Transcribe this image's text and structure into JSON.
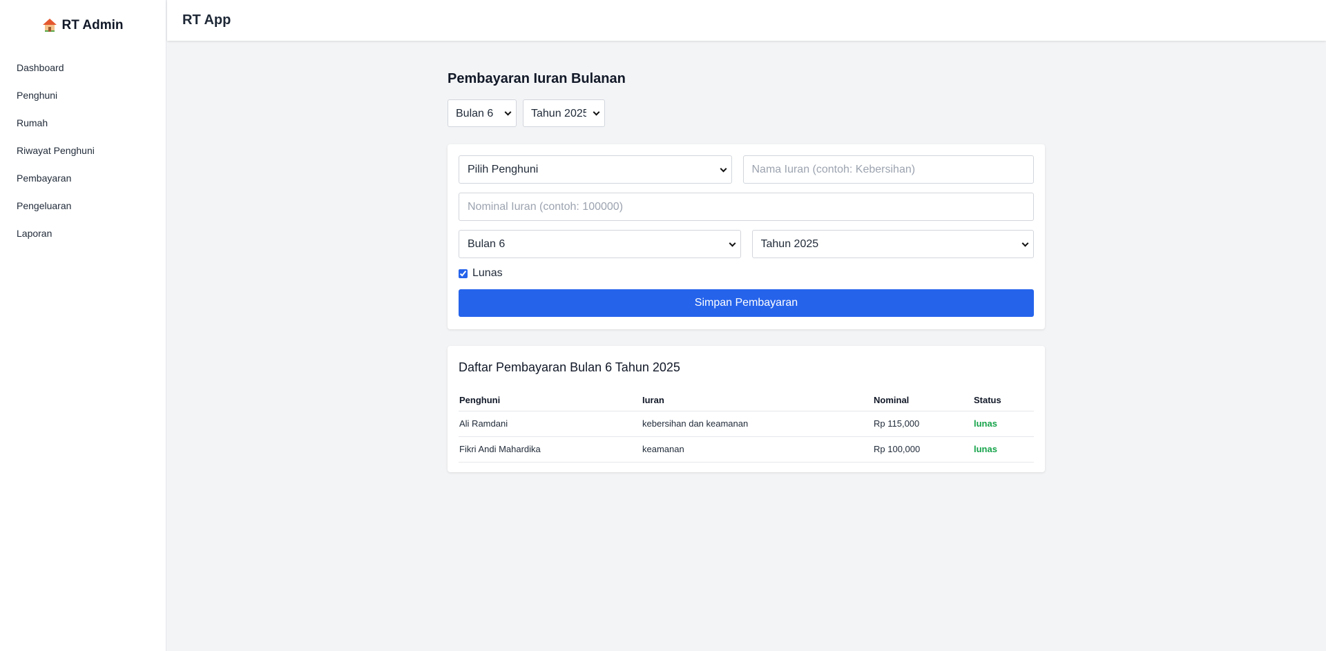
{
  "sidebar": {
    "brand": "RT Admin",
    "brand_icon": "house-icon",
    "items": [
      {
        "label": "Dashboard"
      },
      {
        "label": "Penghuni"
      },
      {
        "label": "Rumah"
      },
      {
        "label": "Riwayat Penghuni"
      },
      {
        "label": "Pembayaran"
      },
      {
        "label": "Pengeluaran"
      },
      {
        "label": "Laporan"
      }
    ]
  },
  "header": {
    "title": "RT App"
  },
  "main": {
    "title": "Pembayaran Iuran Bulanan",
    "filter": {
      "month": "Bulan 6",
      "year": "Tahun 2025"
    },
    "form": {
      "resident_select": "Pilih Penghuni",
      "fee_name_placeholder": "Nama Iuran (contoh: Kebersihan)",
      "amount_placeholder": "Nominal Iuran (contoh: 100000)",
      "month": "Bulan 6",
      "year": "Tahun 2025",
      "paid_label": "Lunas",
      "paid_checked": true,
      "submit_label": "Simpan Pembayaran"
    },
    "list": {
      "title": "Daftar Pembayaran Bulan 6 Tahun 2025",
      "columns": [
        "Penghuni",
        "Iuran",
        "Nominal",
        "Status"
      ],
      "rows": [
        {
          "resident": "Ali Ramdani",
          "fee": "kebersihan dan keamanan",
          "amount": "Rp 115,000",
          "status": "lunas"
        },
        {
          "resident": "Fikri Andi Mahardika",
          "fee": "keamanan",
          "amount": "Rp 100,000",
          "status": "lunas"
        }
      ]
    }
  },
  "colors": {
    "accent": "#2563eb",
    "status_paid": "#16a34a",
    "background": "#f3f4f6"
  }
}
